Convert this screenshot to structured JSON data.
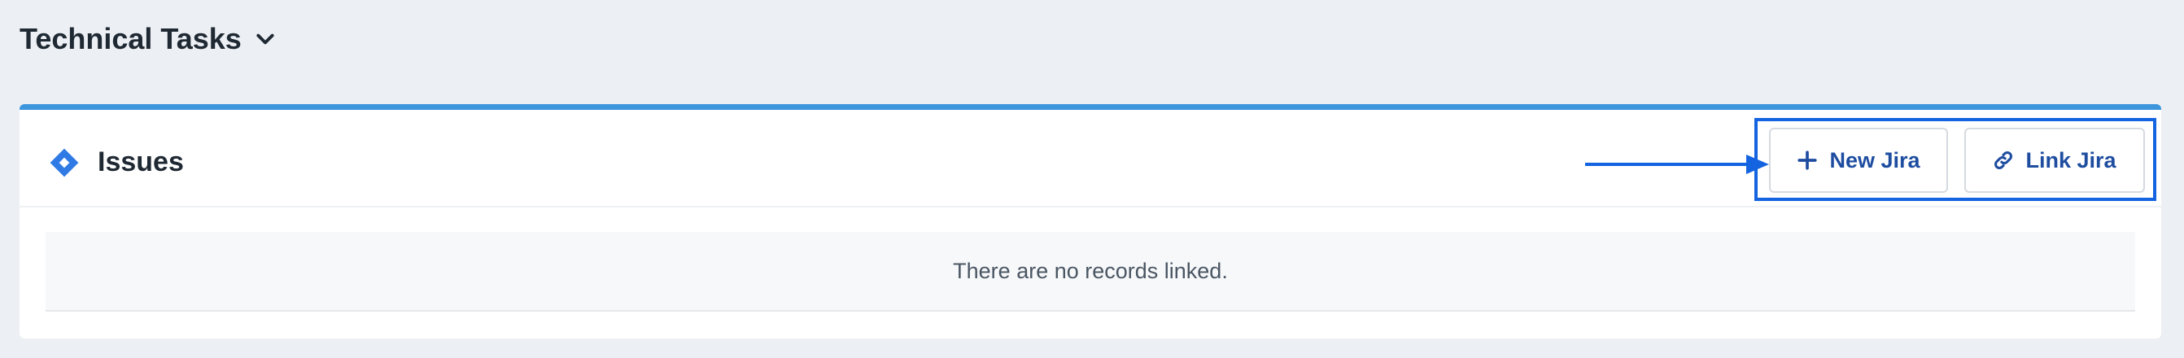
{
  "section": {
    "title": "Technical Tasks",
    "toggle_icon": "chevron-down-icon"
  },
  "panel": {
    "title": "Issues",
    "icon": "jira-diamond-icon",
    "accent_color": "#3d95dc",
    "annotation_color": "#1463e0",
    "empty_message": "There are no records linked."
  },
  "actions": {
    "new_jira": {
      "label": "New Jira",
      "icon": "plus-icon"
    },
    "link_jira": {
      "label": "Link Jira",
      "icon": "link-icon"
    }
  }
}
